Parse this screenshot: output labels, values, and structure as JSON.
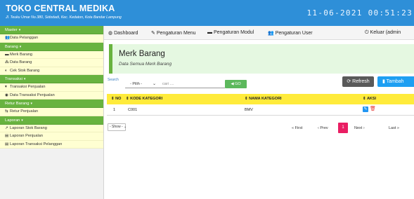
{
  "header": {
    "brand": "TOKO CENTRAL MEDIKA",
    "address": "Jl. Teuku Umar No.380, Sidodadi, Kec. Kedaton, Kota Bandar Lampung",
    "clock": "11-06-2021 00:51:23"
  },
  "sidebar": {
    "sections": [
      {
        "label": "Master",
        "items": [
          {
            "icon": "users-icon",
            "label": "Data Pelanggan"
          }
        ]
      },
      {
        "label": "Barang",
        "items": [
          {
            "icon": "folder-icon",
            "label": "Merk Barang"
          },
          {
            "icon": "cubes-icon",
            "label": "Data Barang"
          },
          {
            "icon": "circle-icon",
            "label": "Cek Stok Barang"
          }
        ]
      },
      {
        "label": "Transaksi",
        "items": [
          {
            "icon": "cart-icon",
            "label": "Transaksi Penjualan"
          },
          {
            "icon": "database-icon",
            "label": "Data Transaksi Penjualan"
          }
        ]
      },
      {
        "label": "Retur Barang",
        "items": [
          {
            "icon": "retur-icon",
            "label": "Retur Penjualan"
          }
        ]
      },
      {
        "label": "Laporan",
        "items": [
          {
            "icon": "chart-icon",
            "label": "Laporan Stok Barang"
          },
          {
            "icon": "print-icon",
            "label": "Laporan Penjualan"
          },
          {
            "icon": "print-icon",
            "label": "Laporan Transaksi Pelanggan"
          }
        ]
      }
    ]
  },
  "navbar": {
    "dashboard": "Dashboard",
    "pengaturan_menu": "Pengaturan Menu",
    "pengaturan_modul": "Pengaturan Modul",
    "pengaturan_user": "Pengaturan User",
    "keluar": "Keluar (admin"
  },
  "page": {
    "title": "Merk Barang",
    "subtitle": "Data Semua Merk Barang"
  },
  "search": {
    "label": "Search",
    "select_value": "- Pilih -",
    "placeholder": "cari ....",
    "go": "GO"
  },
  "buttons": {
    "refresh": "Refresh",
    "tambah": "Tambah"
  },
  "table": {
    "columns": [
      "NO",
      "KODE KATEGORI",
      "NAMA KATEGORI",
      "AKSI"
    ],
    "rows": [
      {
        "no": "1",
        "kode": "C001",
        "nama": "BMV"
      }
    ]
  },
  "pagination": {
    "show": "- Show -",
    "first": "« First",
    "prev": "‹ Prev",
    "current": "1",
    "next": "Next ›",
    "last": "Last »"
  },
  "colors": {
    "header": "#2e8fd8",
    "sidebar_section": "#68b33f",
    "sidebar_item": "#ffffd2",
    "table_header": "#ffeb3b",
    "pagination_active": "#e91e63",
    "button_tambah": "#1e9ff2",
    "button_go": "#5cb85c"
  }
}
